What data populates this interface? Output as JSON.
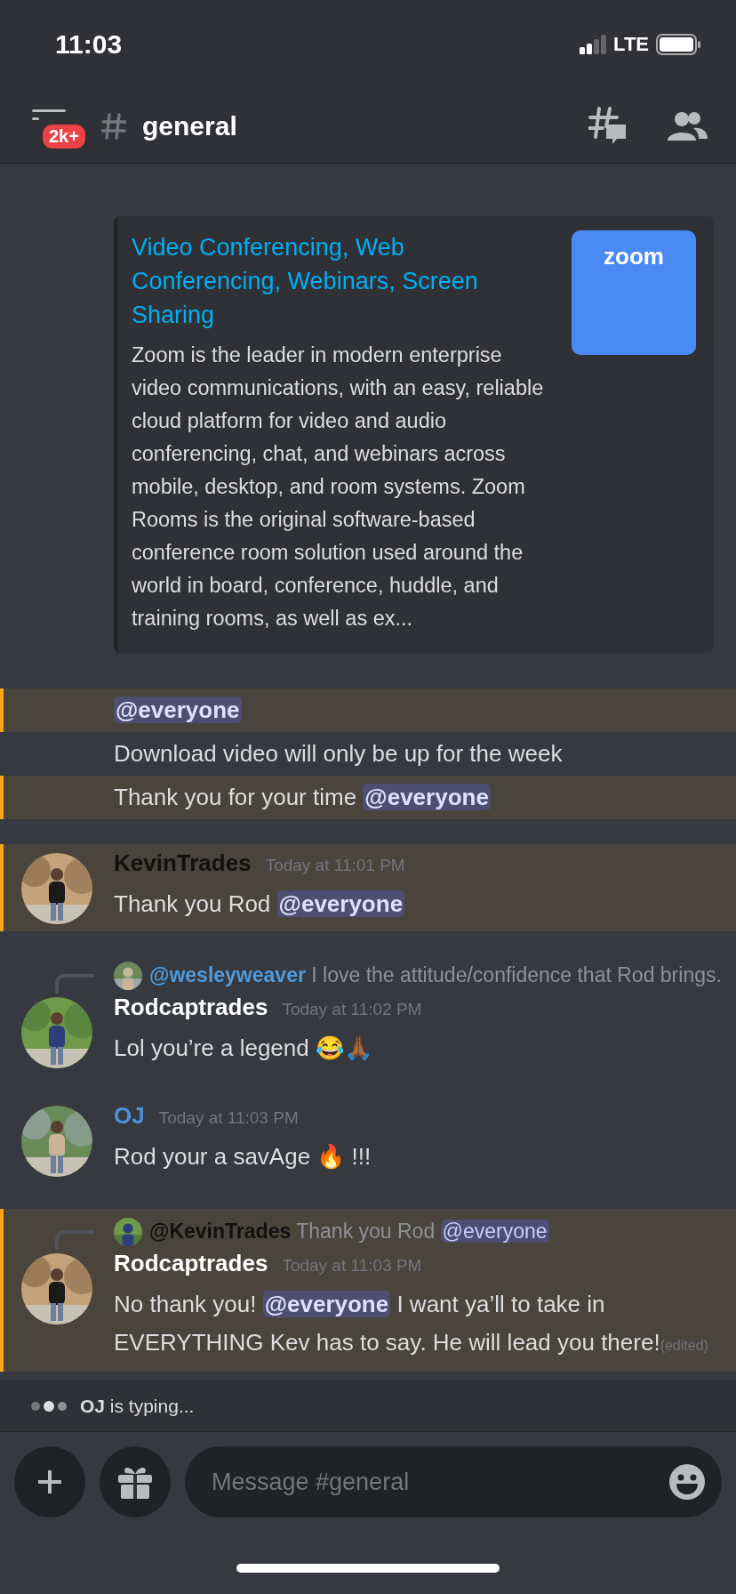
{
  "status_bar": {
    "time": "11:03",
    "network": "LTE"
  },
  "header": {
    "badge": "2k+",
    "channel": "general"
  },
  "embed": {
    "title": "Video Conferencing, Web Conferencing, Webinars, Screen Sharing",
    "description": "Zoom is the leader in modern enterprise video communications, with an easy, reliable cloud platform for video and audio conferencing, chat, and webinars across mobile, desktop, and room systems. Zoom Rooms is the original software-based conference room solution used around the world in board, conference, huddle, and training rooms, as well as ex...",
    "thumbnail_text": "zoom"
  },
  "messages": [
    {
      "kind": "line",
      "highlighted": true,
      "segments": [
        {
          "text": "@everyone",
          "mention": true
        }
      ]
    },
    {
      "kind": "line",
      "highlighted": false,
      "segments": [
        {
          "text": "Download video will only be up for the week",
          "mention": false
        }
      ]
    },
    {
      "kind": "line",
      "highlighted": true,
      "segments": [
        {
          "text": "Thank you for your time ",
          "mention": false
        },
        {
          "text": "@everyone",
          "mention": true
        }
      ]
    },
    {
      "kind": "post",
      "highlighted": true,
      "avatar": {
        "kind": "picture"
      },
      "author": "KevinTrades",
      "color": "#111111",
      "timestamp": "Today at 11:01 PM",
      "segments": [
        {
          "text": "Thank you Rod ",
          "mention": false
        },
        {
          "text": "@everyone",
          "mention": true
        }
      ]
    },
    {
      "kind": "post",
      "highlighted": false,
      "avatar": {
        "kind": "picture"
      },
      "reply": {
        "author": "@wesleyweaver",
        "color": "#4f9bde",
        "segments": [
          {
            "text": "I love the attitude/confidence that Rod brings.",
            "mention": false
          }
        ]
      },
      "author": "Rodcaptrades",
      "color": "#ffffff",
      "timestamp": "Today at 11:02 PM",
      "segments": [
        {
          "text": "Lol you’re a legend 😂🙏🏾",
          "mention": false
        }
      ]
    },
    {
      "kind": "post",
      "highlighted": false,
      "avatar": {
        "kind": "picture"
      },
      "author": "OJ",
      "color": "#4e8fd6",
      "timestamp": "Today at 11:03 PM",
      "segments": [
        {
          "text": "Rod your a savAge 🔥 !!!",
          "mention": false
        }
      ]
    },
    {
      "kind": "post",
      "highlighted": true,
      "avatar": {
        "kind": "picture"
      },
      "reply": {
        "author": "@KevinTrades",
        "color": "#111111",
        "segments": [
          {
            "text": "Thank you Rod ",
            "mention": false
          },
          {
            "text": "@everyone",
            "mention": true
          }
        ]
      },
      "author": "Rodcaptrades",
      "color": "#ffffff",
      "timestamp": "Today at 11:03 PM",
      "segments": [
        {
          "text": "No thank you! ",
          "mention": false
        },
        {
          "text": "@everyone",
          "mention": true
        },
        {
          "text": " I want ya’ll to take in EVERYTHING Kev has to say. He will lead you there!",
          "mention": false
        }
      ],
      "edited": "(edited)"
    }
  ],
  "typing": {
    "text": "**OJ** is typing..."
  },
  "composer": {
    "placeholder": "Message #general"
  }
}
